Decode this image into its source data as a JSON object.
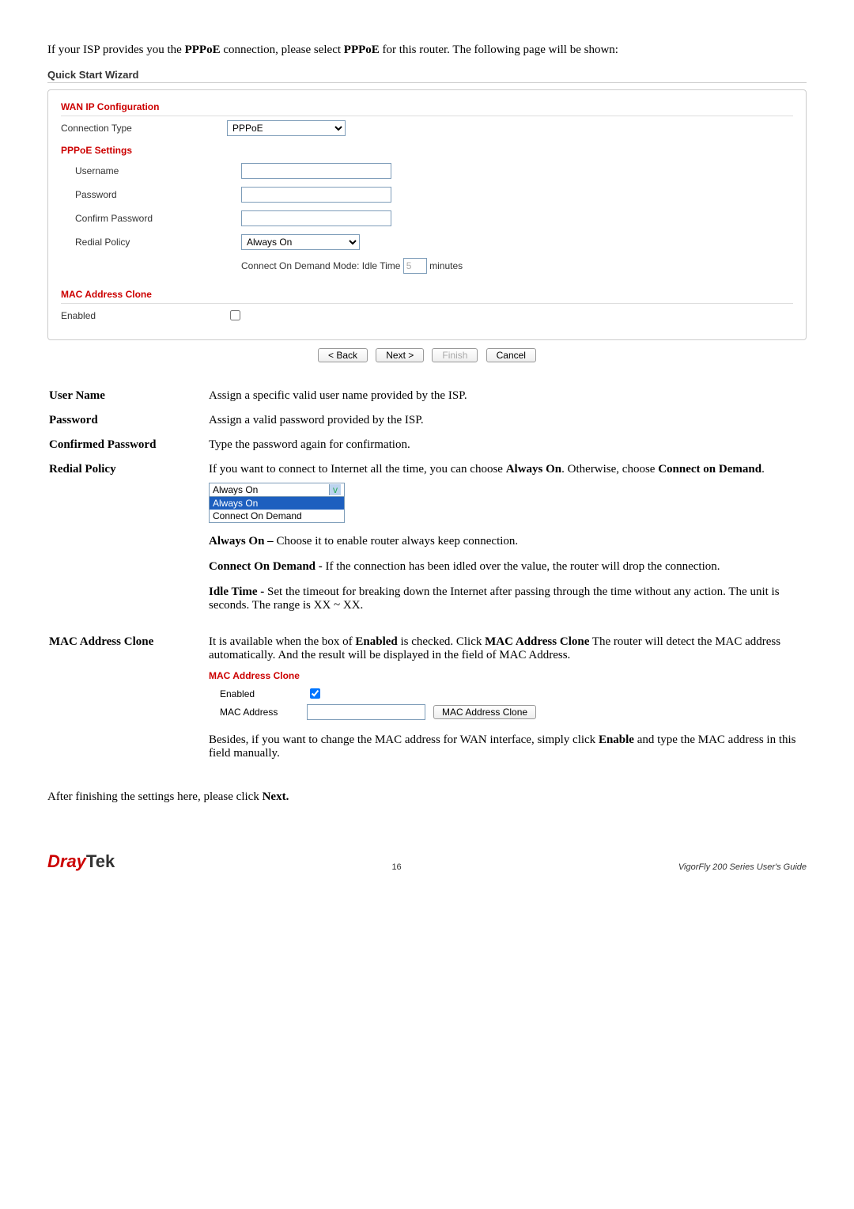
{
  "intro": "If your ISP provides you the PPPoE connection, please select PPPoE for this router. The following page will be shown:",
  "wizard": {
    "title": "Quick Start Wizard",
    "section1": "WAN IP Configuration",
    "connType": {
      "label": "Connection Type",
      "value": "PPPoE"
    },
    "pppoeHead": "PPPoE Settings",
    "username": {
      "label": "Username"
    },
    "password": {
      "label": "Password"
    },
    "confirm": {
      "label": "Confirm Password"
    },
    "redial": {
      "label": "Redial Policy",
      "value": "Always On"
    },
    "idle": {
      "prefix": "Connect On Demand Mode: Idle Time",
      "value": "5",
      "suffix": "minutes"
    },
    "macHead": "MAC Address Clone",
    "enabled": {
      "label": "Enabled"
    },
    "buttons": {
      "back": "< Back",
      "next": "Next >",
      "finish": "Finish",
      "cancel": "Cancel"
    }
  },
  "defs": {
    "userName": {
      "term": "User Name",
      "desc": "Assign a specific valid user name provided by the ISP."
    },
    "password": {
      "term": "Password",
      "desc": "Assign a valid password provided by the ISP."
    },
    "confirmed": {
      "term": "Confirmed Password",
      "desc": "Type the password again for confirmation."
    },
    "redial": {
      "term": "Redial Policy",
      "desc1a": "If you want to connect to Internet all the time, you can choose ",
      "desc1b": "Always On",
      "desc1c": ". Otherwise, choose ",
      "desc1d": "Connect on Demand",
      "desc1e": ".",
      "selCurrent": "Always On",
      "selOpt1": "Always On",
      "selOpt2": "Connect On Demand",
      "alwaysHead": "Always On – ",
      "alwaysBody": "Choose it to enable router always keep connection.",
      "codHead": "Connect On Demand - ",
      "codBody": "If the connection has been idled over the value, the router will drop the connection.",
      "idleHead": "Idle Time - ",
      "idleBody": "Set the timeout for breaking down the Internet after passing through the time without any action. The unit is seconds. The range is XX ~ XX."
    },
    "mac": {
      "term": "MAC Address Clone",
      "body1a": "It is available when the box of ",
      "body1b": "Enabled",
      "body1c": " is checked. Click ",
      "body1d": "MAC Address Clone",
      "body1e": " The router will detect the MAC address automatically. And the result will be displayed in the field of MAC Address.",
      "box": {
        "head": "MAC Address Clone",
        "enabled": "Enabled",
        "addr": "MAC Address",
        "btn": "MAC Address Clone"
      },
      "body2a": "Besides, if you want to change the MAC address for WAN interface, simply click ",
      "body2b": "Enable",
      "body2c": " and type the MAC address in this field manually."
    }
  },
  "closing": {
    "a": "After finishing the settings here, please click ",
    "b": "Next."
  },
  "footer": {
    "logo1": "Dray",
    "logo2": "Tek",
    "page": "16",
    "guide": "VigorFly 200 Series User's Guide"
  }
}
